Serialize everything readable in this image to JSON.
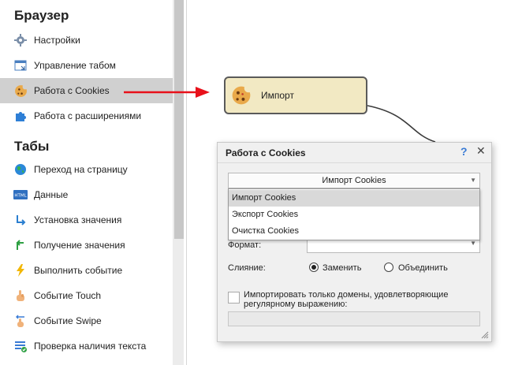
{
  "sidebar": {
    "section_browser": "Браузер",
    "browser_items": [
      {
        "label": "Настройки",
        "icon": "gear-icon"
      },
      {
        "label": "Управление табом",
        "icon": "tab-manage-icon"
      },
      {
        "label": "Работа с Cookies",
        "icon": "cookie-icon",
        "selected": true
      },
      {
        "label": "Работа с расширениями",
        "icon": "puzzle-icon"
      }
    ],
    "section_tabs": "Табы",
    "tab_items": [
      {
        "label": "Переход на страницу",
        "icon": "globe-icon"
      },
      {
        "label": "Данные",
        "icon": "html-icon",
        "badge": "HTML"
      },
      {
        "label": "Установка значения",
        "icon": "arrow-down-right-icon"
      },
      {
        "label": "Получение значения",
        "icon": "arrow-up-right-icon"
      },
      {
        "label": "Выполнить событие",
        "icon": "lightning-icon"
      },
      {
        "label": "Событие Touch",
        "icon": "hand-icon"
      },
      {
        "label": "Событие Swipe",
        "icon": "swipe-icon"
      },
      {
        "label": "Проверка наличия текста",
        "icon": "text-check-icon"
      }
    ]
  },
  "node": {
    "label": "Импорт",
    "icon": "cookie-icon"
  },
  "dialog": {
    "title": "Работа с Cookies",
    "help": "?",
    "close": "✕",
    "action_value": "Импорт Cookies",
    "dropdown_options": [
      "Импорт Cookies",
      "Экспорт Cookies",
      "Очистка Cookies"
    ],
    "format_label": "Формат:",
    "merge_label": "Слияние:",
    "merge_options": [
      "Заменить",
      "Объединить"
    ],
    "checkbox_label_line1": "Импортировать только домены, удовлетворяющие",
    "checkbox_label_line2": "регулярному выражению:"
  },
  "colors": {
    "arrow": "#e8101a",
    "node_fill": "#f2e9c3",
    "selected_row": "#d0d0d0"
  }
}
